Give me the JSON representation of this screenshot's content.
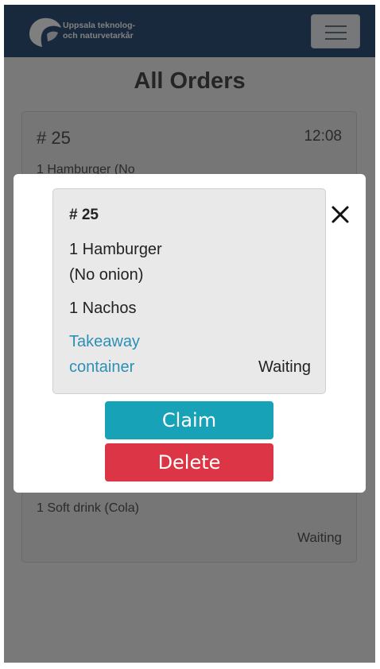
{
  "header": {
    "brand_line1": "Uppsala teknolog-",
    "brand_line2": "och naturvetarkår",
    "logo_icon": "uppsala-logo-icon",
    "menu_icon": "hamburger-menu-icon"
  },
  "page": {
    "title": "All Orders"
  },
  "background_orders": [
    {
      "number": "# 25",
      "time": "12:08",
      "line": "1 Hamburger (No"
    },
    {
      "line": "1 Soft drink (Cola)",
      "status": "Waiting"
    }
  ],
  "modal": {
    "close_icon": "close-icon",
    "order": {
      "number": "# 25",
      "item1_line1": "1 Hamburger",
      "item1_line2": "(No onion)",
      "item2": "1 Nachos",
      "takeaway_line1": "Takeaway",
      "takeaway_line2": "container",
      "status": "Waiting"
    },
    "claim_label": "Claim",
    "delete_label": "Delete"
  },
  "colors": {
    "header_bg": "#31537a",
    "claim": "#18a2b8",
    "delete": "#dc3545",
    "takeaway_text": "#2e8fb5"
  }
}
